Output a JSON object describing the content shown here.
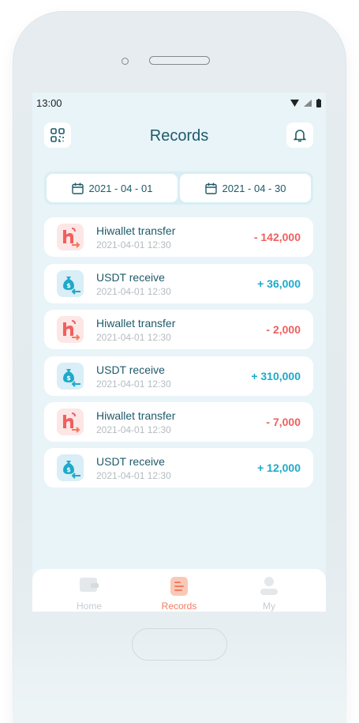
{
  "status_bar": {
    "time": "13:00"
  },
  "header": {
    "title": "Records"
  },
  "date_range": {
    "start": "2021 - 04 - 01",
    "end": "2021 - 04 - 30"
  },
  "records": [
    {
      "title": "Hiwallet transfer",
      "time": "2021-04-01 12:30",
      "amount": "- 142,000",
      "type": "out"
    },
    {
      "title": "USDT receive",
      "time": "2021-04-01 12:30",
      "amount": "+ 36,000",
      "type": "in"
    },
    {
      "title": "Hiwallet transfer",
      "time": "2021-04-01 12:30",
      "amount": "- 2,000",
      "type": "out"
    },
    {
      "title": "USDT receive",
      "time": "2021-04-01 12:30",
      "amount": "+ 310,000",
      "type": "in"
    },
    {
      "title": "Hiwallet transfer",
      "time": "2021-04-01 12:30",
      "amount": "- 7,000",
      "type": "out"
    },
    {
      "title": "USDT receive",
      "time": "2021-04-01 12:30",
      "amount": "+ 12,000",
      "type": "in"
    }
  ],
  "tabs": [
    {
      "label": "Home",
      "icon": "wallet-icon",
      "active": false
    },
    {
      "label": "Records",
      "icon": "records-icon",
      "active": true
    },
    {
      "label": "My",
      "icon": "user-icon",
      "active": false
    }
  ],
  "colors": {
    "negative": "#ef5f5f",
    "positive": "#1ea9c9",
    "accent": "#f27b5e",
    "title": "#1e5a69"
  }
}
